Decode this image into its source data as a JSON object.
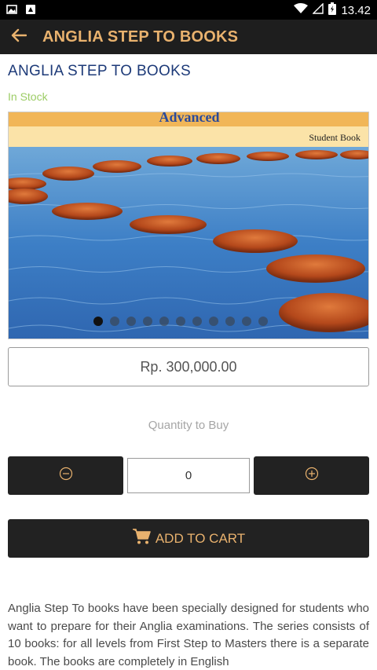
{
  "status_bar": {
    "time": "13.42",
    "icons": [
      "gallery-icon",
      "notification-icon",
      "wifi-icon",
      "signal-icon",
      "battery-icon"
    ]
  },
  "app_bar": {
    "title": "ANGLIA STEP TO BOOKS",
    "back_icon": "arrow-left-icon"
  },
  "product": {
    "name": "ANGLIA STEP TO BOOKS",
    "stock_status": "In Stock",
    "image": {
      "banner_text": "Advanced",
      "label": "Student Book"
    },
    "carousel_dots": 11,
    "carousel_active_index": 0,
    "price": "Rp. 300,000.00"
  },
  "quantity": {
    "label": "Quantity to Buy",
    "value": "0",
    "minus_icon": "minus-circle-icon",
    "plus_icon": "plus-circle-icon"
  },
  "cart": {
    "label": "ADD TO CART",
    "icon": "cart-icon"
  },
  "description": "Anglia Step To books have been specially designed for students who want to prepare for their Anglia examinations. The series consists of 10 books: for all levels from First Step to Masters there is a separate book. The books are completely in English",
  "colors": {
    "accent": "#e9b26e",
    "title_blue": "#1d3a78",
    "stock_green": "#9ccc65",
    "dark": "#222222"
  }
}
